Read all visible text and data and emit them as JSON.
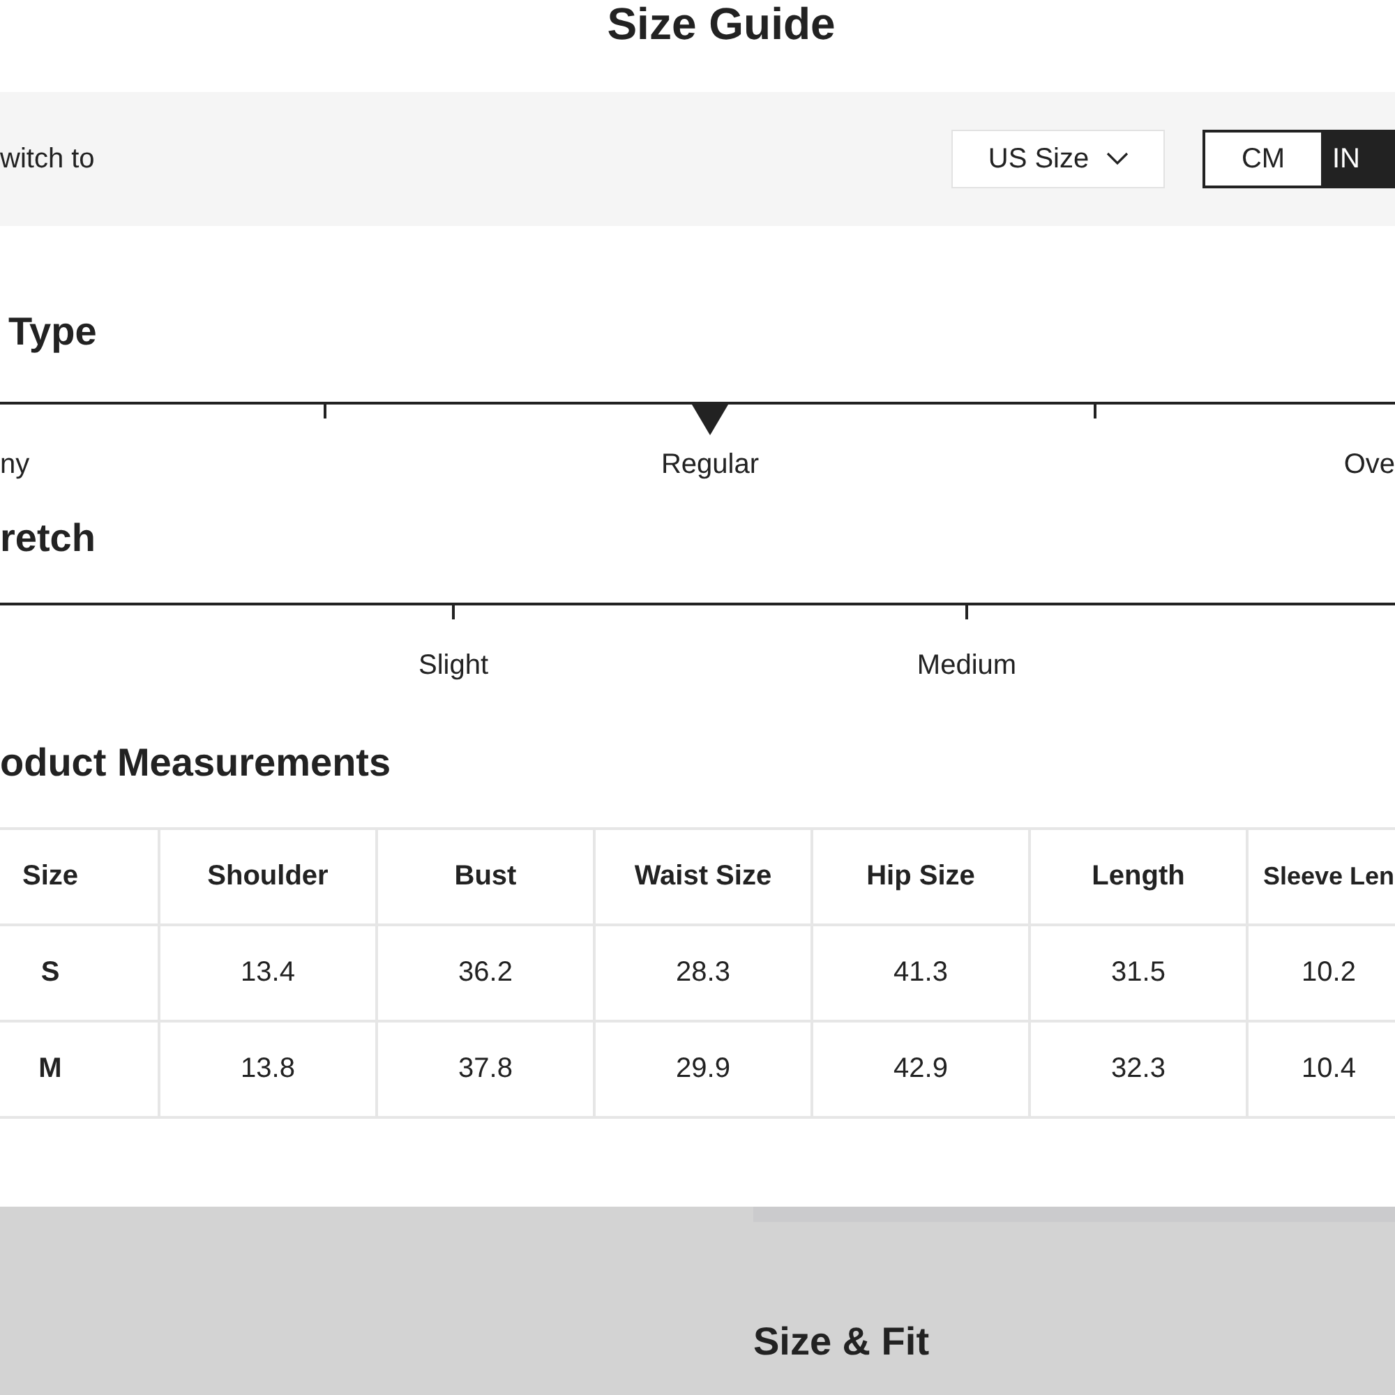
{
  "title": "Size Guide",
  "switch_bar": {
    "label": "witch to",
    "size_system": "US Size",
    "units": [
      {
        "label": "CM",
        "selected": false
      },
      {
        "label": "IN",
        "selected": true
      }
    ]
  },
  "fit_type": {
    "title": "Type",
    "options": [
      {
        "label": "ny",
        "selected": false
      },
      {
        "label": "Regular",
        "selected": true
      },
      {
        "label": "Ove",
        "selected": false
      }
    ]
  },
  "stretch": {
    "title": "retch",
    "options": [
      {
        "label": "Slight"
      },
      {
        "label": "Medium"
      }
    ]
  },
  "measurements": {
    "title": "oduct Measurements",
    "columns": [
      "Size",
      "Shoulder",
      "Bust",
      "Waist Size",
      "Hip Size",
      "Length",
      "Sleeve Len"
    ],
    "rows": [
      [
        "S",
        "13.4",
        "36.2",
        "28.3",
        "41.3",
        "31.5",
        "10.2"
      ],
      [
        "M",
        "13.8",
        "37.8",
        "29.9",
        "42.9",
        "32.3",
        "10.4"
      ]
    ]
  },
  "footer": {
    "title": "Size & Fit"
  }
}
